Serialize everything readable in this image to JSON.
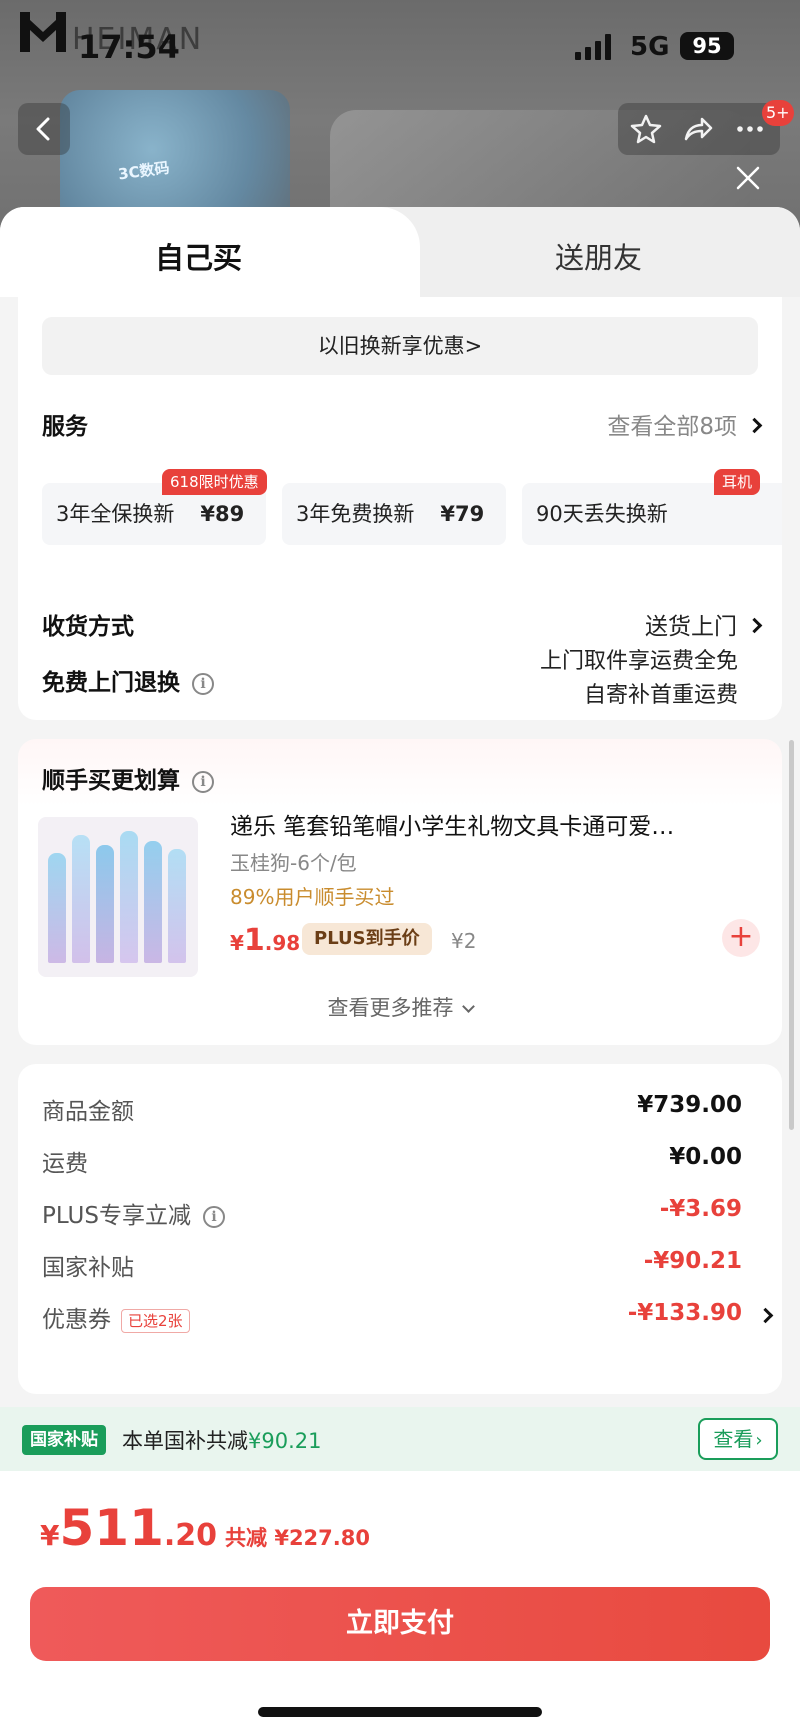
{
  "status_bar": {
    "watermark": "HEIMAN",
    "time": "17:54",
    "network": "5G",
    "battery": "95"
  },
  "background_nav": {
    "badge": "5+",
    "banner_label": "3C数码"
  },
  "tabs": [
    {
      "label": "自己买"
    },
    {
      "label": "送朋友"
    }
  ],
  "trade_in": {
    "label": "以旧换新享优惠>"
  },
  "services": {
    "title": "服务",
    "view_all": "查看全部8项",
    "items": [
      {
        "name": "3年全保换新",
        "price": "¥89",
        "tag": "618限时优惠"
      },
      {
        "name": "3年免费换新",
        "price": "¥79",
        "tag": ""
      },
      {
        "name": "90天丢失换新",
        "price": "",
        "tag": "耳机"
      }
    ]
  },
  "delivery": {
    "title": "收货方式",
    "value": "送货上门"
  },
  "free_return": {
    "title": "免费上门退换",
    "line1": "上门取件享运费全免",
    "line2": "自寄补首重运费"
  },
  "addon": {
    "title": "顺手买更划算",
    "product": {
      "title": "递乐 笔套铅笔帽小学生礼物文具卡通可爱…",
      "spec": "玉桂狗-6个/包",
      "rate": "89%用户顺手买过",
      "price_currency": "¥",
      "price_int": "1",
      "price_dec": ".98",
      "plus_tag": "PLUS到手价",
      "original_price": "¥2"
    },
    "more": "查看更多推荐"
  },
  "fees": {
    "goods": {
      "label": "商品金额",
      "value": "¥739.00"
    },
    "shipping": {
      "label": "运费",
      "value": "¥0.00"
    },
    "plus_discount": {
      "label": "PLUS专享立减",
      "value": "-¥3.69"
    },
    "subsidy": {
      "label": "国家补贴",
      "value": "-¥90.21"
    },
    "coupon": {
      "label": "优惠券",
      "picked": "已选2张",
      "value": "-¥133.90"
    }
  },
  "subsidy_bar": {
    "tag": "国家补贴",
    "text": "本单国补共减",
    "amount": "¥90.21",
    "button": "查看"
  },
  "footer": {
    "currency": "¥",
    "total_int": "511",
    "total_dec": ".20",
    "saved": "共减 ¥227.80",
    "pay_button": "立即支付"
  },
  "colors": {
    "accent_red": "#e8413b",
    "subsidy_green": "#1a9d5a",
    "plus_gold": "#c98c2e"
  }
}
